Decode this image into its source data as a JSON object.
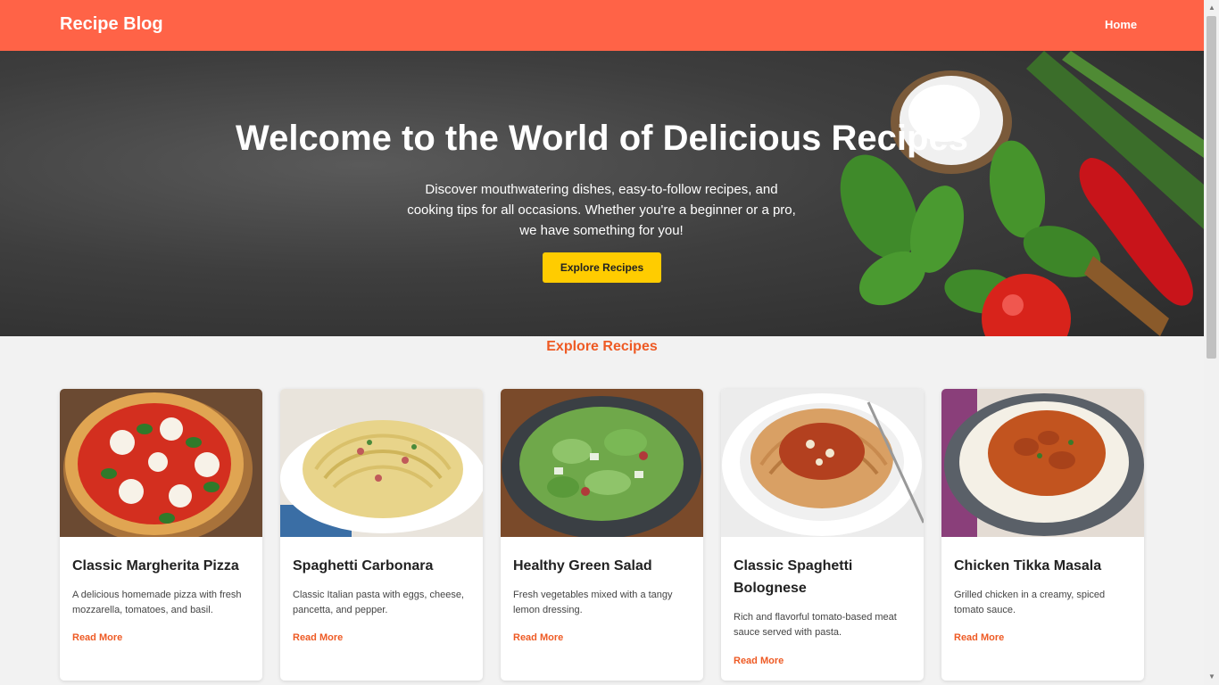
{
  "nav": {
    "brand": "Recipe Blog",
    "home": "Home"
  },
  "hero": {
    "title": "Welcome to the World of Delicious Recipes",
    "subtitle": "Discover mouthwatering dishes, easy-to-follow recipes, and cooking tips for all occasions. Whether you're a beginner or a pro, we have something for you!",
    "button": "Explore Recipes"
  },
  "section": {
    "title": "Explore Recipes"
  },
  "recipes": [
    {
      "title": "Classic Margherita Pizza",
      "desc": "A delicious homemade pizza with fresh mozzarella, tomatoes, and basil.",
      "link": "Read More"
    },
    {
      "title": "Spaghetti Carbonara",
      "desc": "Classic Italian pasta with eggs, cheese, pancetta, and pepper.",
      "link": "Read More"
    },
    {
      "title": "Healthy Green Salad",
      "desc": "Fresh vegetables mixed with a tangy lemon dressing.",
      "link": "Read More"
    },
    {
      "title": "Classic Spaghetti Bolognese",
      "desc": "Rich and flavorful tomato-based meat sauce served with pasta.",
      "link": "Read More"
    },
    {
      "title": "Chicken Tikka Masala",
      "desc": "Grilled chicken in a creamy, spiced tomato sauce.",
      "link": "Read More"
    }
  ],
  "colors": {
    "header": "#ff6347",
    "accent": "#ee5a24",
    "button": "#ffcc00"
  }
}
